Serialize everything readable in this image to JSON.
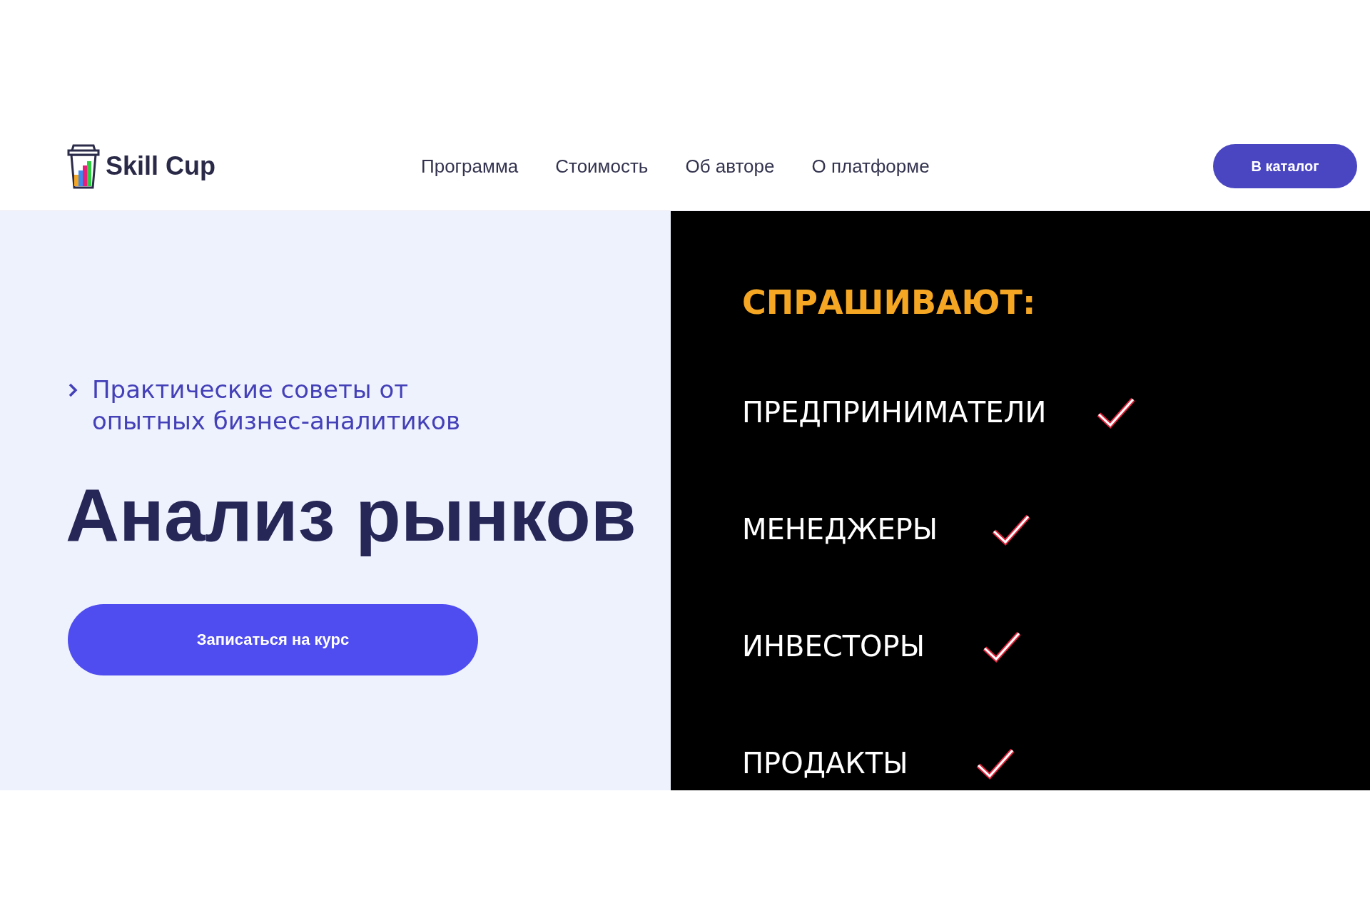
{
  "header": {
    "logo": "Skill Cup",
    "nav": [
      {
        "label": "Программа"
      },
      {
        "label": "Стоимость"
      },
      {
        "label": "Об авторе"
      },
      {
        "label": "О платформе"
      }
    ],
    "button": "В каталог"
  },
  "hero": {
    "subtitle": "Практические советы от опытных бизнес-аналитиков",
    "title": "Анализ рынков",
    "cta": "Записаться на курс"
  },
  "promo": {
    "heading": "СПРАШИВАЮТ:",
    "items": [
      {
        "label": "ПРЕДПРИНИМАТЕЛИ",
        "checked": true
      },
      {
        "label": "МЕНЕДЖЕРЫ",
        "checked": true
      },
      {
        "label": "ИНВЕСТОРЫ",
        "checked": true
      },
      {
        "label": "ПРОДАКТЫ",
        "checked": true
      }
    ]
  }
}
